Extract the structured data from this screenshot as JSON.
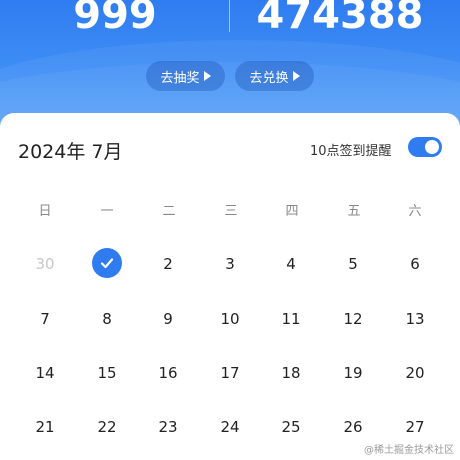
{
  "header": {
    "stat_left": "999",
    "stat_right": "474388",
    "buttons": [
      {
        "label": "去抽奖"
      },
      {
        "label": "去兑换"
      }
    ]
  },
  "calendar": {
    "month_title": "2024年 7月",
    "reminder_label": "10点签到提醒",
    "reminder_on": true,
    "weekdays": [
      "日",
      "一",
      "二",
      "三",
      "四",
      "五",
      "六"
    ],
    "rows": [
      [
        "30",
        "1",
        "2",
        "3",
        "4",
        "5",
        "6"
      ],
      [
        "7",
        "8",
        "9",
        "10",
        "11",
        "12",
        "13"
      ],
      [
        "14",
        "15",
        "16",
        "17",
        "18",
        "19",
        "20"
      ],
      [
        "21",
        "22",
        "23",
        "24",
        "25",
        "26",
        "27"
      ]
    ],
    "checked_day": "1",
    "muted_days": [
      "30"
    ]
  },
  "watermark": "@稀土掘金技术社区",
  "colors": {
    "accent": "#2f7cf0",
    "muted_text": "#c8c8c8"
  }
}
